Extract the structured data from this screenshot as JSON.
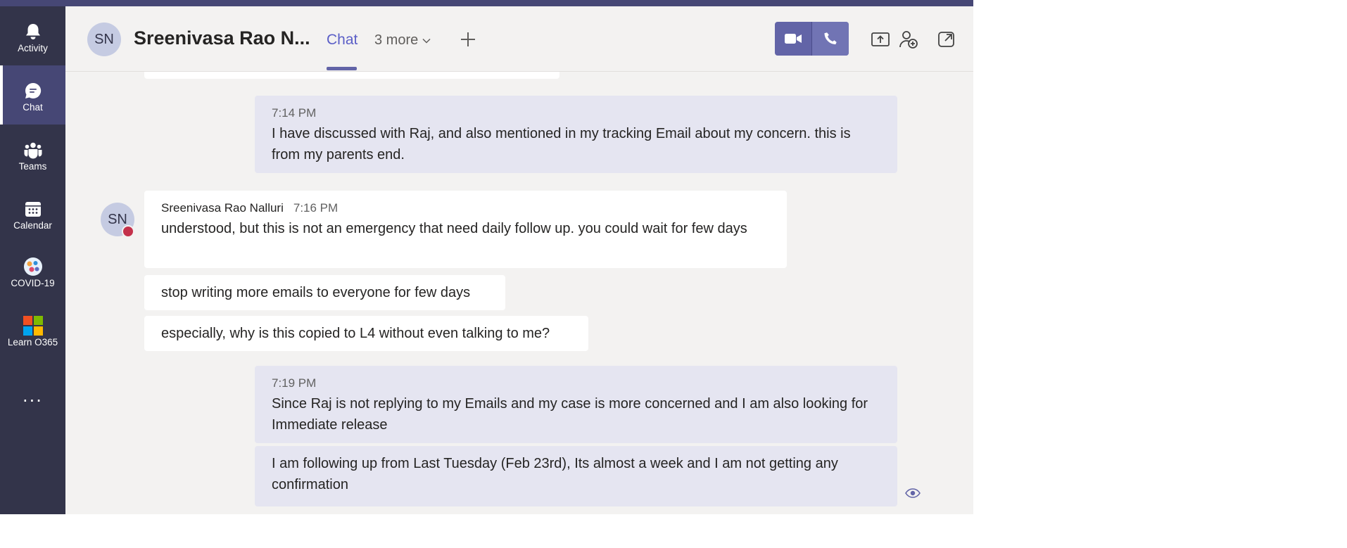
{
  "rail": {
    "items": [
      {
        "label": "Activity",
        "icon": "bell-icon"
      },
      {
        "label": "Chat",
        "icon": "chat-icon",
        "active": true
      },
      {
        "label": "Teams",
        "icon": "teams-icon"
      },
      {
        "label": "Calendar",
        "icon": "calendar-icon"
      },
      {
        "label": "COVID-19",
        "icon": "covid-app-icon"
      },
      {
        "label": "Learn O365",
        "icon": "microsoft-logo-icon"
      }
    ],
    "more": "..."
  },
  "header": {
    "avatar_initials": "SN",
    "title": "Sreenivasa Rao N...",
    "tab_chat": "Chat",
    "tab_more": "3 more"
  },
  "messages": [
    {
      "id": "m1",
      "mine": true,
      "time": "7:14 PM",
      "text": "I have discussed with Raj, and also mentioned in my tracking Email about my concern. this is from my parents end."
    },
    {
      "id": "m2",
      "mine": false,
      "sender": "Sreenivasa Rao Nalluri",
      "time": "7:16 PM",
      "text": "understood, but this is not an emergency that need daily follow up. you could wait for few days"
    },
    {
      "id": "m3",
      "mine": false,
      "text": "stop writing more emails to everyone for few days"
    },
    {
      "id": "m4",
      "mine": false,
      "text": "especially, why is this copied to L4 without even talking to me?"
    },
    {
      "id": "m5",
      "mine": true,
      "time": "7:19 PM",
      "text": "Since Raj is not replying to my Emails and my case is more concerned and I am also looking for Immediate release"
    },
    {
      "id": "m6",
      "mine": true,
      "text": "I am following up from Last Tuesday (Feb 23rd), Its almost a week and I am not getting any confirmation"
    }
  ],
  "message_avatar_initials": "SN",
  "colors": {
    "accent": "#6264a7",
    "rail_bg": "#33344a",
    "mine_bubble": "#e5e5f1",
    "other_bubble": "#ffffff",
    "presence_busy": "#c4314b"
  }
}
